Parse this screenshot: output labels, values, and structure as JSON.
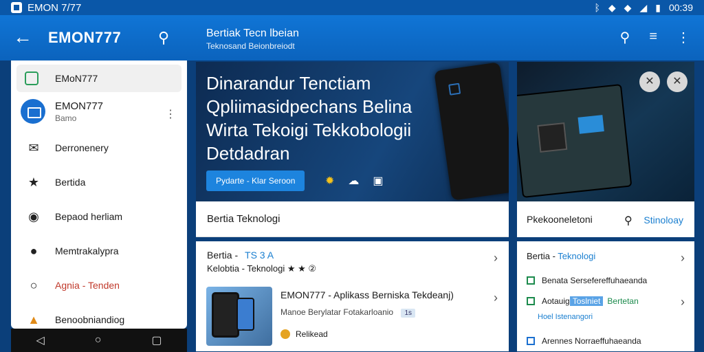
{
  "status": {
    "app_name": "EMON 7/77",
    "time": "00:39"
  },
  "app_bar": {
    "title": "EMON777",
    "center_title": "Bertiak Tecn lbeian",
    "center_subtitle": "Teknosand Beionbreiodt"
  },
  "drawer": {
    "top_item": "EMoN777",
    "profile_name": "EMON777",
    "profile_sub": "Bamo",
    "items": [
      {
        "label": "Derronenery",
        "icon": "envelope-icon"
      },
      {
        "label": "Bertida",
        "icon": "star-icon"
      },
      {
        "label": "Bepaod herliam",
        "icon": "chat-icon"
      },
      {
        "label": "Memtrakalypra",
        "icon": "comment-icon"
      },
      {
        "label": "Agnia - Tenden",
        "icon": "search-icon"
      },
      {
        "label": "Benoobniandiog",
        "icon": "fire-icon"
      }
    ]
  },
  "hero": {
    "headline": "Dinarandur Tenctiam Qpliimasidpechans Belina Wirta Tekoigi Tekkobologii Detdadran",
    "cta": "Pydarte - Klar Seroon"
  },
  "center": {
    "section_title": "Bertia  Teknologi",
    "card": {
      "row1_label": "Bertia -",
      "row1_accent": "TS 3 A",
      "row2": "Kelobtia - Teknologi ★ ★ ②",
      "title": "EMON777 - Aplikass Berniska Tekdeanj)",
      "desc": "Manoe Berylatar  Fotakarloanio",
      "desc_badge": "1s",
      "meta": "Relikead"
    }
  },
  "right": {
    "section_title": "Pkekooneletoni",
    "section_link": "Stinoloay",
    "list_head_label": "Bertia - ",
    "list_head_accent": "Teknologi",
    "item1": "Benata Sersefereffuhaeanda",
    "item2_label": "Aotauig",
    "item2_highlight": "Toslniet",
    "item2_green": "Bertetan",
    "item2_sub": "Hoel Istenangori",
    "item3": "Arennes Norraeffuhaeanda"
  }
}
